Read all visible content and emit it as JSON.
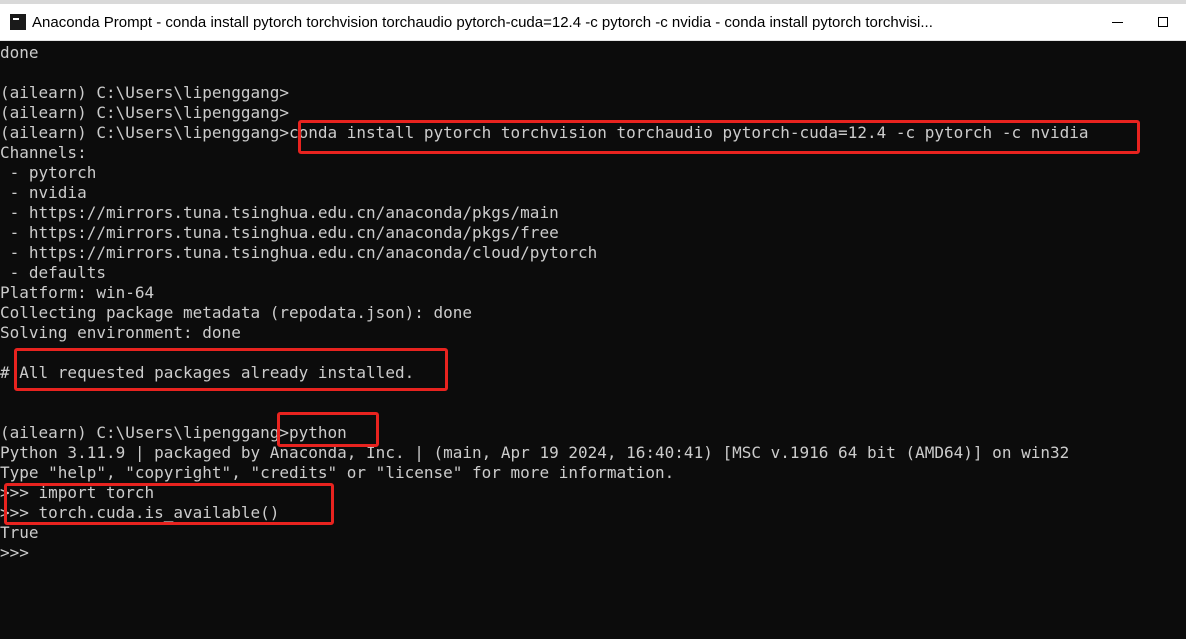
{
  "window": {
    "title": "Anaconda Prompt - conda  install pytorch torchvision torchaudio pytorch-cuda=12.4 -c pytorch -c nvidia - conda  install pytorch torchvisi..."
  },
  "terminal": {
    "lines": [
      "done",
      "",
      "(ailearn) C:\\Users\\lipenggang>",
      "(ailearn) C:\\Users\\lipenggang>",
      "(ailearn) C:\\Users\\lipenggang>conda install pytorch torchvision torchaudio pytorch-cuda=12.4 -c pytorch -c nvidia",
      "Channels:",
      " - pytorch",
      " - nvidia",
      " - https://mirrors.tuna.tsinghua.edu.cn/anaconda/pkgs/main",
      " - https://mirrors.tuna.tsinghua.edu.cn/anaconda/pkgs/free",
      " - https://mirrors.tuna.tsinghua.edu.cn/anaconda/cloud/pytorch",
      " - defaults",
      "Platform: win-64",
      "Collecting package metadata (repodata.json): done",
      "Solving environment: done",
      "",
      "# All requested packages already installed.",
      "",
      "",
      "(ailearn) C:\\Users\\lipenggang>python",
      "Python 3.11.9 | packaged by Anaconda, Inc. | (main, Apr 19 2024, 16:40:41) [MSC v.1916 64 bit (AMD64)] on win32",
      "Type \"help\", \"copyright\", \"credits\" or \"license\" for more information.",
      ">>> import torch",
      ">>> torch.cuda.is_available()",
      "True",
      ">>>"
    ]
  }
}
